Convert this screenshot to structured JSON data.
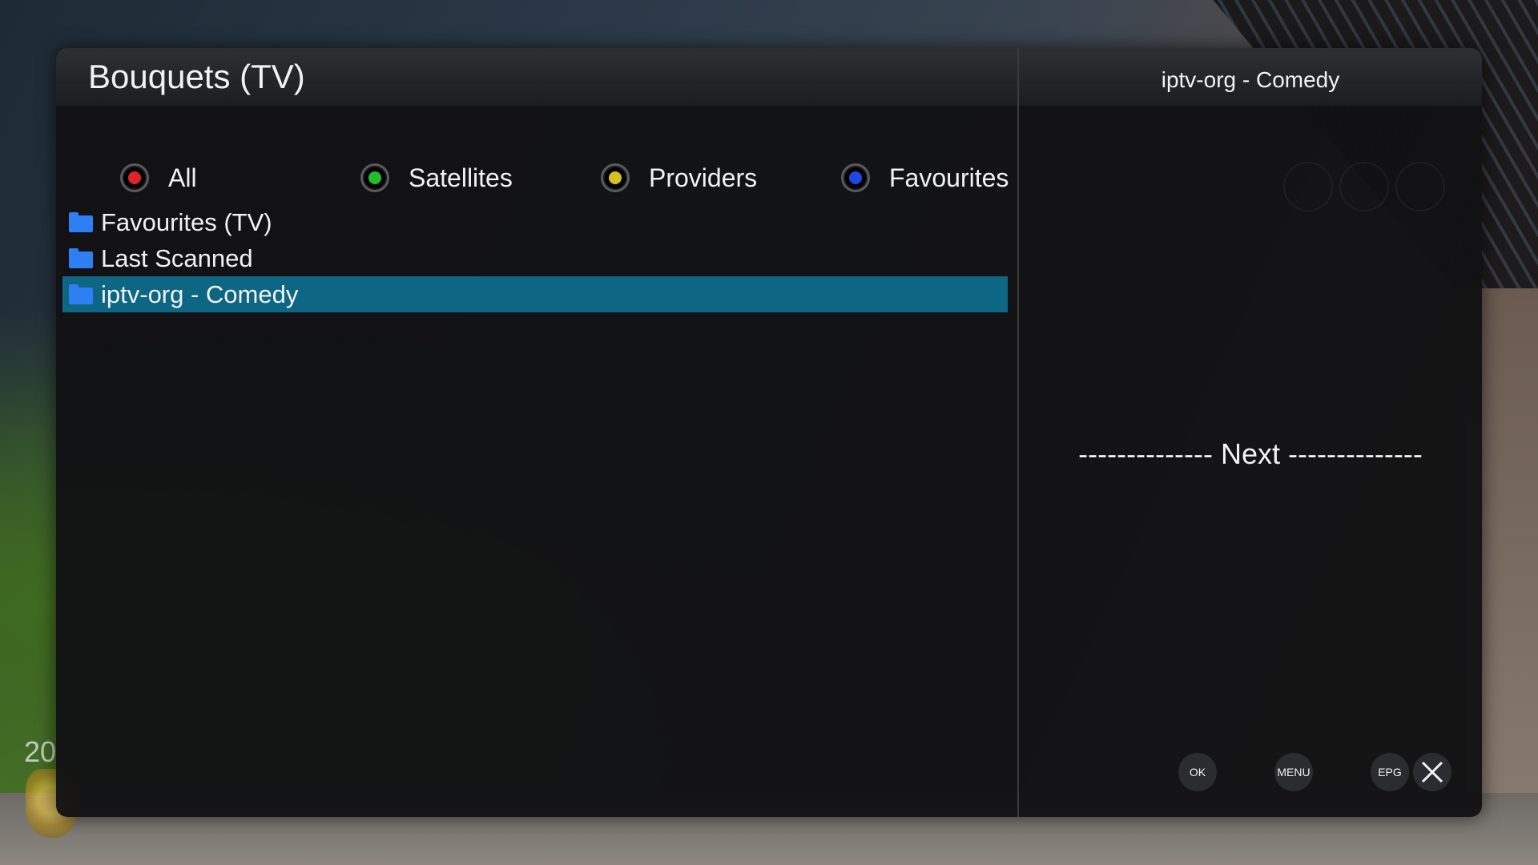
{
  "colors": {
    "panel_bg": "#121214",
    "selected_bg": "#0d6683",
    "folder_icon": "#2e7ef4",
    "red": "#e02424",
    "green": "#1fbe2a",
    "yellow": "#d7c11a",
    "blue": "#1f47e6"
  },
  "background": {
    "stamp_text": "20"
  },
  "left_panel": {
    "title": "Bouquets (TV)",
    "color_buttons": [
      {
        "label": "All",
        "color": "#e02424"
      },
      {
        "label": "Satellites",
        "color": "#1fbe2a"
      },
      {
        "label": "Providers",
        "color": "#d7c11a"
      },
      {
        "label": "Favourites",
        "color": "#1f47e6"
      }
    ],
    "bouquets": [
      {
        "label": "Favourites (TV)",
        "icon": "folder-icon",
        "selected": false
      },
      {
        "label": "Last Scanned",
        "icon": "folder-icon",
        "selected": false
      },
      {
        "label": "iptv-org - Comedy",
        "icon": "folder-icon",
        "selected": true
      }
    ]
  },
  "right_panel": {
    "title": "iptv-org - Comedy",
    "next_label": "-------------- Next --------------",
    "buttons": [
      {
        "label": "OK"
      },
      {
        "label": "MENU"
      },
      {
        "label": "EPG"
      }
    ],
    "close_icon": "close-icon"
  }
}
